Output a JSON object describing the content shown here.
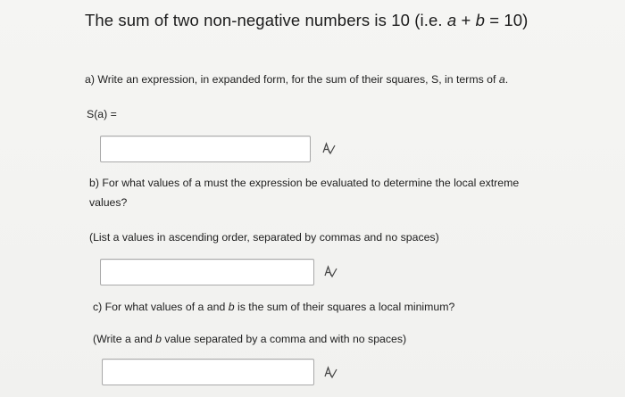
{
  "title": {
    "prefix": "The sum of two non-negative numbers is 10 (i.e. ",
    "var_a": "a",
    "plus": " + ",
    "var_b": "b",
    "suffix": " = 10)"
  },
  "part_a": {
    "prompt": "a) Write an expression, in expanded form, for the sum of their squares, S, in terms of ",
    "var": "a",
    "end": ".",
    "label": "S(a) =",
    "answer": "",
    "icon": "symbol-editor-icon"
  },
  "part_b": {
    "prompt": "b) For what values of a must the expression be evaluated to determine the local extreme values?",
    "instruction": "(List a values in ascending order, separated by commas and no spaces)",
    "answer": "",
    "icon": "symbol-editor-icon"
  },
  "part_c": {
    "prompt_1": "c) For what values of a and ",
    "var_b": "b",
    "prompt_2": " is the sum of their squares a local minimum?",
    "instruction_1": "(Write a and ",
    "instruction_var": "b",
    "instruction_2": " value separated by a comma and with no spaces)",
    "answer": "",
    "icon": "symbol-editor-icon"
  }
}
